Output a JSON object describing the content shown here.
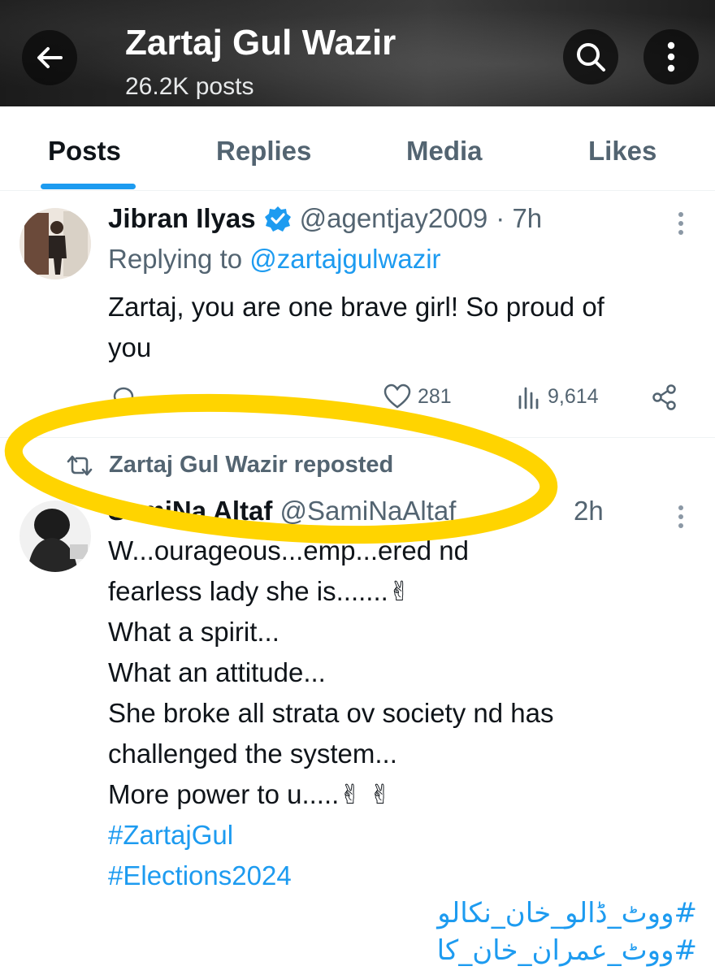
{
  "header": {
    "title": "Zartaj Gul Wazir",
    "posts_count": "26.2K posts"
  },
  "tabs": [
    {
      "label": "Posts",
      "active": true
    },
    {
      "label": "Replies"
    },
    {
      "label": "Media"
    },
    {
      "label": "Likes"
    }
  ],
  "tweet1": {
    "name": "Jibran Ilyas",
    "verified": true,
    "handle": "@agentjay2009",
    "time": "· 7h",
    "replying_prefix": "Replying to",
    "replying_to": "@zartajgulwazir",
    "text_lines": [
      "Zartaj, you are one brave girl! So proud of",
      "you"
    ],
    "likes": "281",
    "views": "9,614"
  },
  "tweet2": {
    "repost_label": "Zartaj Gul Wazir reposted",
    "name": "SamiNa Altaf",
    "handle": "@SamiNaAltaf",
    "time": "2h",
    "partial_line": "W...ourageous...emp...ered nd",
    "text_lines": [
      "fearless lady she is.......✌",
      "What a spirit...",
      "What an attitude...",
      "She broke all strata ov society nd has",
      "challenged the system...",
      "More power to u.....✌ ✌"
    ],
    "hashtags": [
      "#ZartajGul",
      "#Elections2024"
    ]
  },
  "overlay_text": [
    "#ووٹ_ڈالو_خان_نکالو",
    "#ووٹ_عمران_خان_کا"
  ],
  "colors": {
    "accent": "#1d9bf0",
    "highlight": "#ffd400",
    "text": "#0f1419",
    "muted": "#536471"
  }
}
